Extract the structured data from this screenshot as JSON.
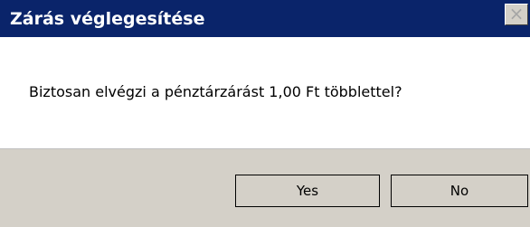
{
  "window": {
    "title": "Zárás véglegesítése",
    "close_label": "×"
  },
  "content": {
    "message": "Biztosan elvégzi a pénztárzárást 1,00 Ft többlettel?"
  },
  "buttons": {
    "yes": "Yes",
    "no": "No"
  }
}
